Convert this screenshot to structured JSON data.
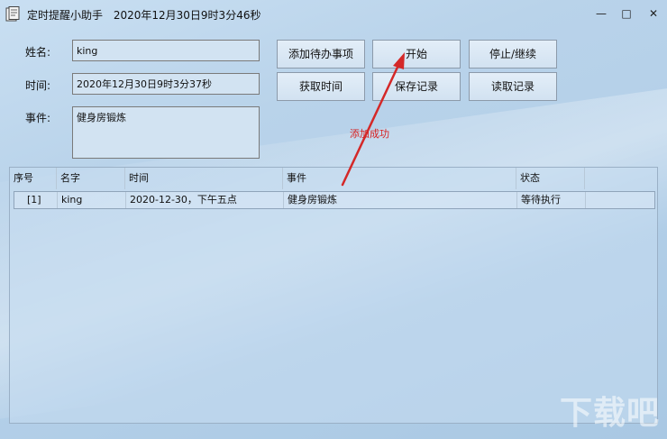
{
  "window": {
    "title": "定时提醒小助手",
    "title_time": "2020年12月30日9时3分46秒",
    "minimize_glyph": "—",
    "maximize_glyph": "□",
    "close_glyph": "✕"
  },
  "form": {
    "name_label": "姓名:",
    "name_value": "king",
    "time_label": "时间:",
    "time_value": "2020年12月30日9时3分37秒",
    "event_label": "事件:",
    "event_value": "健身房锻炼"
  },
  "buttons": {
    "add_todo": "添加待办事项",
    "start": "开始",
    "stop_continue": "停止/继续",
    "get_time": "获取时间",
    "save_record": "保存记录",
    "read_record": "读取记录"
  },
  "status_message": "添加成功",
  "list": {
    "columns": [
      "序号",
      "名字",
      "时间",
      "事件",
      "状态"
    ],
    "rows": [
      {
        "index": "[1]",
        "name": "king",
        "time": "2020-12-30，下午五点",
        "event": "健身房锻炼",
        "status": "等待执行"
      }
    ]
  },
  "watermark": "下载吧",
  "colors": {
    "annotation_arrow": "#d42828",
    "status_text": "#d82020"
  },
  "icons": {
    "app": "app-document-icon",
    "annotation": "red-arrow-annotation"
  }
}
